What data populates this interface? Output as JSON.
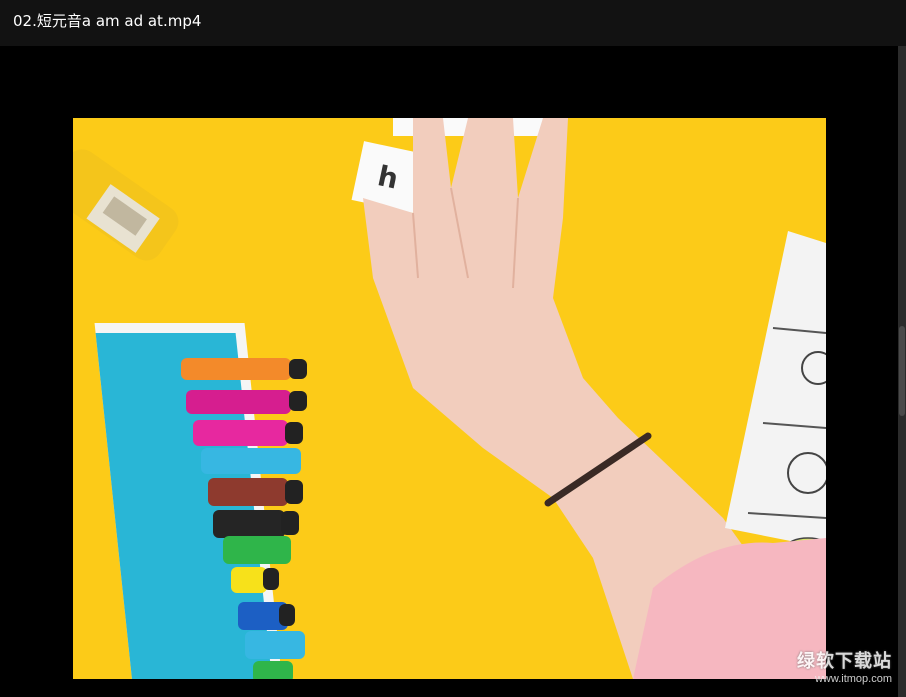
{
  "window": {
    "title": "02.短元音a am ad at.mp4"
  },
  "video": {
    "frame_icon": "video-frame",
    "colors": {
      "background": "#fdd01e",
      "book": "#29b6d6",
      "skin": "#f1c8b5",
      "sleeve": "#f6b7c0"
    }
  },
  "watermark": {
    "name": "绿软下载站",
    "url": "www.itmop.com"
  }
}
